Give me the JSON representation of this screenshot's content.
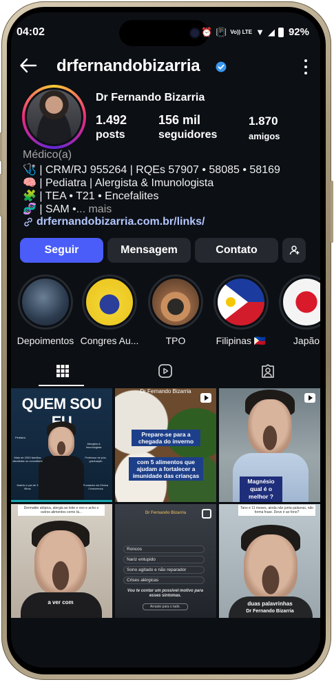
{
  "status_bar": {
    "time": "04:02",
    "battery": "92%",
    "net_label": "Vo)) LTE"
  },
  "header": {
    "username": "drfernandobizarria"
  },
  "profile": {
    "display_name": "Dr Fernando Bizarria",
    "posts": {
      "value": "1.492",
      "label": "posts"
    },
    "followers": {
      "value": "156 mil",
      "label": "seguidores"
    },
    "friends": {
      "value": "1.870",
      "label": "amigos"
    },
    "category": "Médico(a)",
    "bio": [
      "🩺 | CRM/RJ 955264 | RQEs 57907 • 58085 • 58169",
      "🧠 | Pediatra | Alergista & Imunologista",
      "🧩 | TEA • T21 • Encefalites",
      "🧬 | SAM •"
    ],
    "bio_more": "... mais",
    "link": "drfernandobizarria.com.br/links/"
  },
  "actions": {
    "follow": "Seguir",
    "message": "Mensagem",
    "contact": "Contato"
  },
  "highlights": [
    {
      "label": "Depoimentos"
    },
    {
      "label": "Congres Au..."
    },
    {
      "label": "TPO"
    },
    {
      "label": "Filipinas 🇵🇭"
    },
    {
      "label": "Japão"
    }
  ],
  "tabs": [
    {
      "icon": "grid-icon"
    },
    {
      "icon": "reels-icon"
    },
    {
      "icon": "tagged-icon"
    }
  ],
  "posts": {
    "p1": {
      "title": "QUEM SOU EU",
      "tags": [
        "Pediatra",
        "Alergista & Imunologista",
        "Mais de 2000 famílias atendidas no consultório",
        "Professor de pós-graduação",
        "Marido e pai de 3 filhos",
        "Fundador da Clínica Crescermos"
      ]
    },
    "p2": {
      "brand": "Dr Fernando Bizarria",
      "line1": "Prepare-se para a chegada do inverno",
      "line2": "com 5 alimentos que ajudam a fortalecer a imunidade das crianças"
    },
    "p3": {
      "caption": "Magnésio qual é o melhor ?"
    },
    "p4": {
      "top": "Dermatite atópica, alergia ao leite e ovo e acho o outros alimentos como tá...",
      "caption": "a ver com"
    },
    "p5": {
      "brand": "Dr Fernando Bizarria",
      "items": [
        "Roncos",
        "Nariz entupido",
        "Sono agitado e não reparador",
        "Crises alérgicas"
      ],
      "footer": "Vou te contar um possível motivo para esses sintomas.",
      "cta": "Arraste para o lado."
    },
    "p6": {
      "top": "Tano e 11 meses, ainda não junta palavras, não forma frase. Deve ir ao fono?",
      "caption": "duas palavrinhas",
      "brand": "Dr Fernando Bizarria"
    }
  },
  "colors": {
    "accent": "#4a5df9",
    "background": "#0c0f14",
    "button": "#25282e",
    "link": "#b3c7ff",
    "verified": "#3897f0"
  }
}
